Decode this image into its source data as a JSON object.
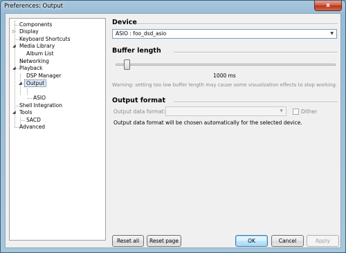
{
  "window": {
    "title": "Preferences: Output",
    "close_glyph": "x"
  },
  "tree": {
    "items": [
      {
        "label": "Components",
        "expander": ""
      },
      {
        "label": "Display",
        "expander": "▷"
      },
      {
        "label": "Keyboard Shortcuts",
        "expander": ""
      },
      {
        "label": "Media Library",
        "expander": "◢"
      },
      {
        "label": "Album List",
        "expander": ""
      },
      {
        "label": "Networking",
        "expander": ""
      },
      {
        "label": "Playback",
        "expander": "◢"
      },
      {
        "label": "DSP Manager",
        "expander": ""
      },
      {
        "label": "Output",
        "expander": "◢",
        "selected": true
      },
      {
        "label": "ASIO",
        "expander": ""
      },
      {
        "label": "Shell Integration",
        "expander": ""
      },
      {
        "label": "Tools",
        "expander": "◢"
      },
      {
        "label": "SACD",
        "expander": ""
      },
      {
        "label": "Advanced",
        "expander": ""
      }
    ]
  },
  "device": {
    "title": "Device",
    "value": "ASIO : foo_dsd_asio"
  },
  "buffer": {
    "title": "Buffer length",
    "value_label": "1000 ms",
    "level_fraction": 0.04,
    "warning": "Warning: setting too low buffer length may cause some visualization effects to stop working."
  },
  "output_format": {
    "title": "Output format",
    "field_label": "Output data format:",
    "field_value": "",
    "dither_label": "Dither",
    "dither_checked": false,
    "info": "Output data format will be chosen automatically for the selected device."
  },
  "buttons": {
    "reset_all": "Reset all",
    "reset_page": "Reset page",
    "ok": "OK",
    "cancel": "Cancel",
    "apply": "Apply"
  },
  "icons": {
    "dropdown": "chevron-down-icon",
    "close": "close-icon"
  }
}
